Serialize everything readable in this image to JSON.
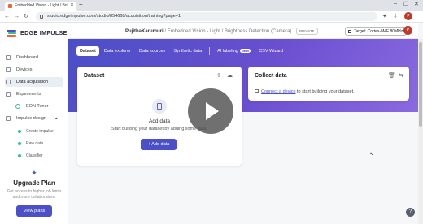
{
  "browser": {
    "tab_title": "Embedded Vision - Light / Bri...",
    "url": "studio.edgeimpulse.com/studio/854668/acquisition/training?page=1",
    "profile_initial": "P"
  },
  "sidebar": {
    "logo_text": "EDGE IMPULSE",
    "items": [
      {
        "label": "Dashboard",
        "icon": "dashboard-icon"
      },
      {
        "label": "Devices",
        "icon": "devices-icon"
      },
      {
        "label": "Data acquisition",
        "icon": "database-icon"
      },
      {
        "label": "Experiments",
        "icon": "experiments-icon"
      },
      {
        "label": "EON Tuner",
        "icon": "tuner-icon"
      },
      {
        "label": "Impulse design",
        "icon": "impulse-icon"
      }
    ],
    "subitems": [
      {
        "label": "Create impulse"
      },
      {
        "label": "Raw data"
      },
      {
        "label": "Classifier"
      }
    ],
    "upgrade": {
      "title": "Upgrade Plan",
      "text": "Get access to higher job limits and more collaborators.",
      "button": "View plans"
    }
  },
  "header": {
    "user": "PujithaKarumuri",
    "project": "Embedded Vision - Light / Brightness Detection (Camera)",
    "visibility": "PRIVATE",
    "target": "Target: Cortex-M4F 80MHz",
    "avatar_initial": "P"
  },
  "subtabs": [
    {
      "label": "Dataset"
    },
    {
      "label": "Data explorer"
    },
    {
      "label": "Data sources"
    },
    {
      "label": "Synthetic data"
    },
    {
      "label": "AI labeling",
      "badge": "NEW"
    },
    {
      "label": "CSV Wizard"
    }
  ],
  "dataset_card": {
    "title": "Dataset",
    "empty_title": "Add data",
    "empty_sub": "Start building your dataset by adding some data.",
    "add_button": "Add data"
  },
  "collect_card": {
    "title": "Collect data",
    "link": "Connect a device",
    "rest": "to start building your dataset."
  },
  "colors": {
    "accent": "#4b50c9",
    "hero_start": "#4a4fc7",
    "hero_end": "#8a6ae0"
  }
}
